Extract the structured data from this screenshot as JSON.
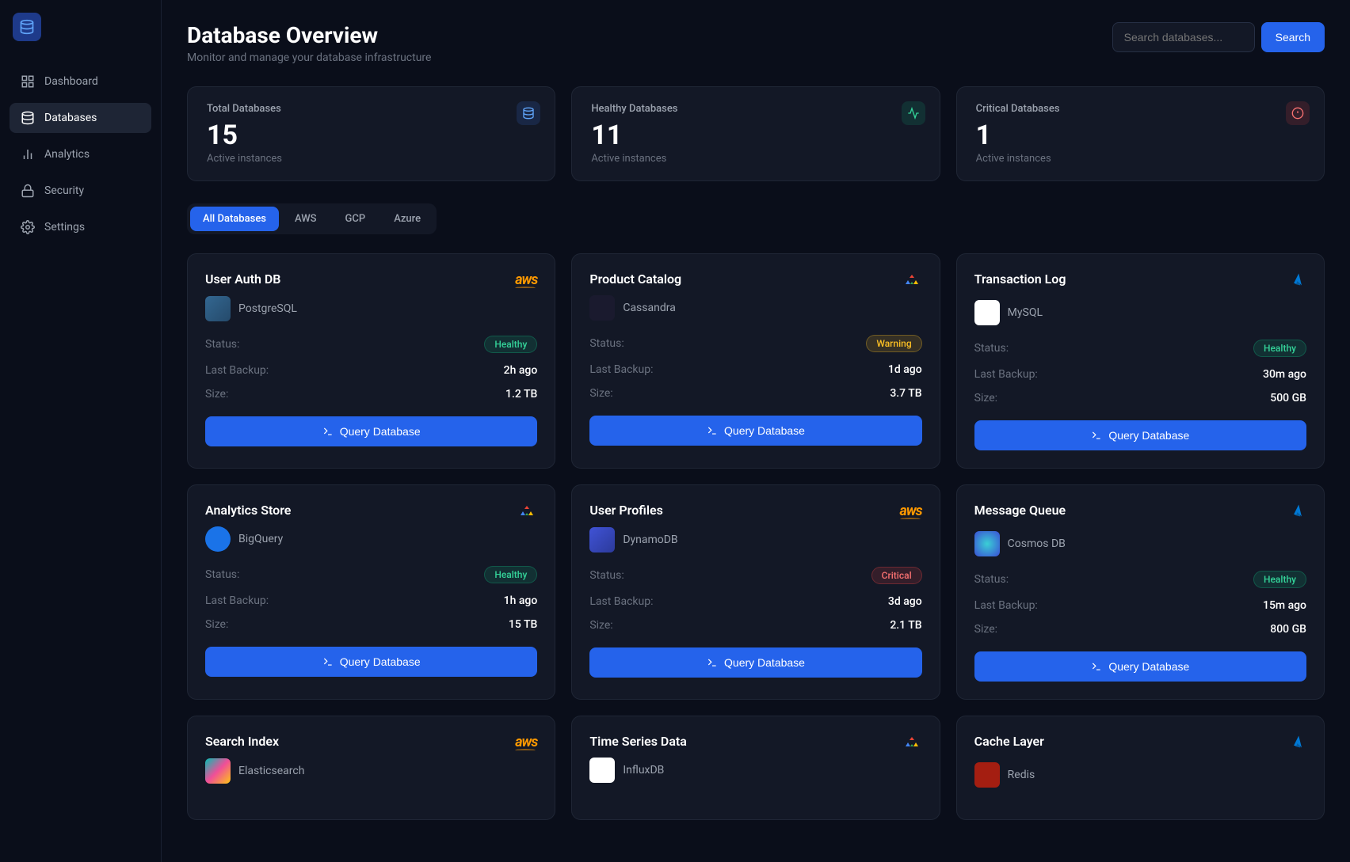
{
  "sidebar": {
    "items": [
      {
        "label": "Dashboard"
      },
      {
        "label": "Databases"
      },
      {
        "label": "Analytics"
      },
      {
        "label": "Security"
      },
      {
        "label": "Settings"
      }
    ]
  },
  "header": {
    "title": "Database Overview",
    "subtitle": "Monitor and manage your database infrastructure"
  },
  "search": {
    "placeholder": "Search databases...",
    "button": "Search"
  },
  "stats": [
    {
      "label": "Total Databases",
      "value": "15",
      "sub": "Active instances"
    },
    {
      "label": "Healthy Databases",
      "value": "11",
      "sub": "Active instances"
    },
    {
      "label": "Critical Databases",
      "value": "1",
      "sub": "Active instances"
    }
  ],
  "filters": [
    "All Databases",
    "AWS",
    "GCP",
    "Azure"
  ],
  "labels": {
    "status": "Status:",
    "backup": "Last Backup:",
    "size": "Size:",
    "query": "Query Database"
  },
  "databases": [
    {
      "name": "User Auth DB",
      "engine": "PostgreSQL",
      "cloud": "aws",
      "status": "Healthy",
      "statusClass": "healthy",
      "backup": "2h ago",
      "size": "1.2 TB",
      "engineClass": "pg"
    },
    {
      "name": "Product Catalog",
      "engine": "Cassandra",
      "cloud": "gcp",
      "status": "Warning",
      "statusClass": "warning",
      "backup": "1d ago",
      "size": "3.7 TB",
      "engineClass": "cass"
    },
    {
      "name": "Transaction Log",
      "engine": "MySQL",
      "cloud": "azure",
      "status": "Healthy",
      "statusClass": "healthy",
      "backup": "30m ago",
      "size": "500 GB",
      "engineClass": "mysql"
    },
    {
      "name": "Analytics Store",
      "engine": "BigQuery",
      "cloud": "gcp",
      "status": "Healthy",
      "statusClass": "healthy",
      "backup": "1h ago",
      "size": "15 TB",
      "engineClass": "bq"
    },
    {
      "name": "User Profiles",
      "engine": "DynamoDB",
      "cloud": "aws",
      "status": "Critical",
      "statusClass": "critical",
      "backup": "3d ago",
      "size": "2.1 TB",
      "engineClass": "ddb"
    },
    {
      "name": "Message Queue",
      "engine": "Cosmos DB",
      "cloud": "azure",
      "status": "Healthy",
      "statusClass": "healthy",
      "backup": "15m ago",
      "size": "800 GB",
      "engineClass": "cosmos"
    },
    {
      "name": "Search Index",
      "engine": "Elasticsearch",
      "cloud": "aws",
      "status": "",
      "statusClass": "",
      "backup": "",
      "size": "",
      "engineClass": "es"
    },
    {
      "name": "Time Series Data",
      "engine": "InfluxDB",
      "cloud": "gcp",
      "status": "",
      "statusClass": "",
      "backup": "",
      "size": "",
      "engineClass": "influx"
    },
    {
      "name": "Cache Layer",
      "engine": "Redis",
      "cloud": "azure",
      "status": "",
      "statusClass": "",
      "backup": "",
      "size": "",
      "engineClass": "redis"
    }
  ]
}
